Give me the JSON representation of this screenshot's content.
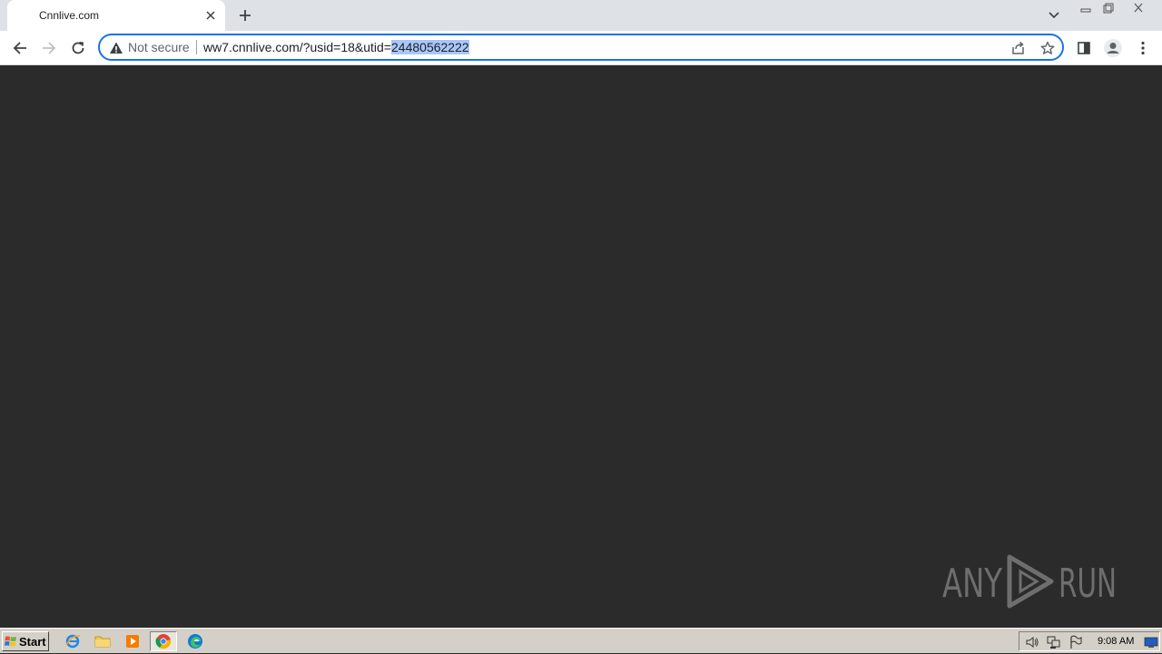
{
  "browser": {
    "tab": {
      "title": "Cnnlive.com"
    },
    "omnibox": {
      "security_label": "Not secure",
      "url_prefix": "ww7.cnnlive.com/?usid=18&utid=",
      "url_selected": "24480562222"
    }
  },
  "watermark": {
    "text": "ANY RUN"
  },
  "taskbar": {
    "start_label": "Start",
    "clock": "9:08 AM"
  },
  "colors": {
    "page_bg": "#2b2b2b",
    "accent": "#1a73e8",
    "selection": "#a8c7fa",
    "taskbar": "#d4d0c8"
  }
}
